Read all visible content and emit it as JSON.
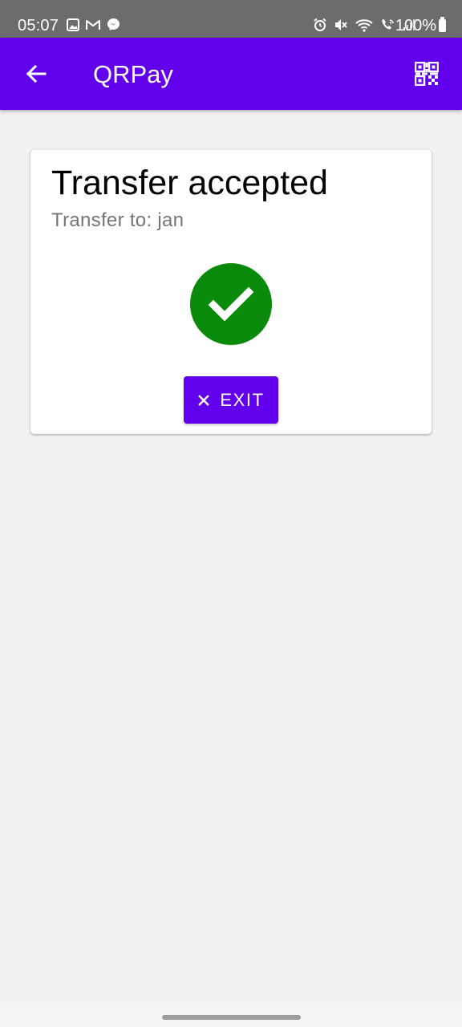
{
  "status_bar": {
    "time": "05:07",
    "battery": "100%",
    "left_icons": [
      "image-icon",
      "gmail-icon",
      "messenger-icon"
    ],
    "right_icons": [
      "alarm-icon",
      "mute-icon",
      "wifi-icon",
      "wifi-call-icon",
      "signal-icon",
      "battery-icon"
    ]
  },
  "app_bar": {
    "title": "QRPay",
    "back_icon": "arrow-back-icon",
    "action_icon": "qr-code-icon"
  },
  "card": {
    "title": "Transfer accepted",
    "subtitle": "Transfer to: jan",
    "status_icon": "check-circle-icon",
    "exit_button": {
      "icon": "close-icon",
      "label": "EXIT"
    }
  },
  "colors": {
    "primary": "#6200ee",
    "success": "#0a8a0a",
    "background": "#f1f1f1",
    "status_bar": "#6c6c6c"
  }
}
